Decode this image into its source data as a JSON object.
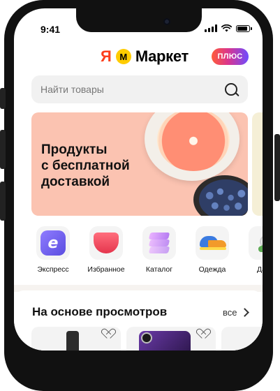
{
  "status_bar": {
    "time": "9:41"
  },
  "header": {
    "logo_ya": "Я",
    "logo_mark": "М",
    "logo_text": "Маркет",
    "plus_badge": "ПЛЮС"
  },
  "search": {
    "placeholder": "Найти товары",
    "value": "",
    "icon": "search-icon"
  },
  "banner": {
    "title": "Продукты\nс бесплатной\nдоставкой",
    "background": "#fbc3b1"
  },
  "categories": [
    {
      "label": "Экспресс",
      "icon": "express-icon"
    },
    {
      "label": "Избранное",
      "icon": "favorites-heart-icon"
    },
    {
      "label": "Каталог",
      "icon": "catalog-layers-icon"
    },
    {
      "label": "Одежда",
      "icon": "sneaker-icon"
    },
    {
      "label": "Дача",
      "icon": "garden-icon"
    }
  ],
  "recommendations": {
    "title": "На основе просмотров",
    "see_all": "все"
  },
  "colors": {
    "brand_red": "#fc3f1d",
    "brand_yellow": "#ffcc00",
    "plus_gradient_start": "#ff5c3a",
    "plus_gradient_end": "#6e4cff"
  }
}
